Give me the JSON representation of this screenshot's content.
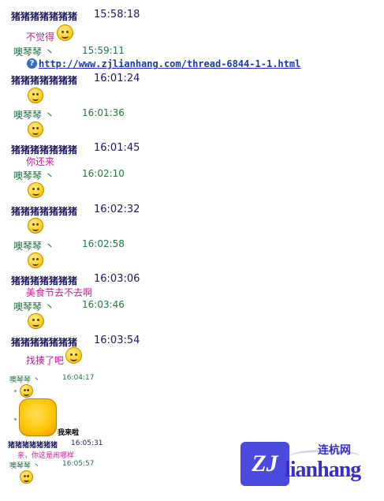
{
  "users": {
    "a": "猪猪猪猪猪猪猪",
    "b": "噢琴琴 丶"
  },
  "messages": [
    {
      "time": "15:58:18",
      "text": "不觉得"
    },
    {
      "time": "15:59:11",
      "link": "http://www.zjlianhang.com/thread-6844-1-1.html"
    },
    {
      "time": "16:01:24"
    },
    {
      "time": "16:01:36"
    },
    {
      "time": "16:01:45",
      "text": "你还来"
    },
    {
      "time": "16:02:10"
    },
    {
      "time": "16:02:32"
    },
    {
      "time": "16:02:58"
    },
    {
      "time": "16:03:06",
      "text": "美食节去不去啊"
    },
    {
      "time": "16:03:46"
    },
    {
      "time": "16:03:54",
      "text": "找揍了吧"
    },
    {
      "time": "16:04:17"
    },
    {
      "sticker_caption": "我来啦"
    },
    {
      "time": "16:05:31",
      "text": "亲，你这是闹哪样"
    },
    {
      "time": "16:05:57"
    }
  ],
  "watermark": {
    "logo": "ZJ",
    "brand": "lianhang",
    "brand_cn": "连杭网"
  }
}
